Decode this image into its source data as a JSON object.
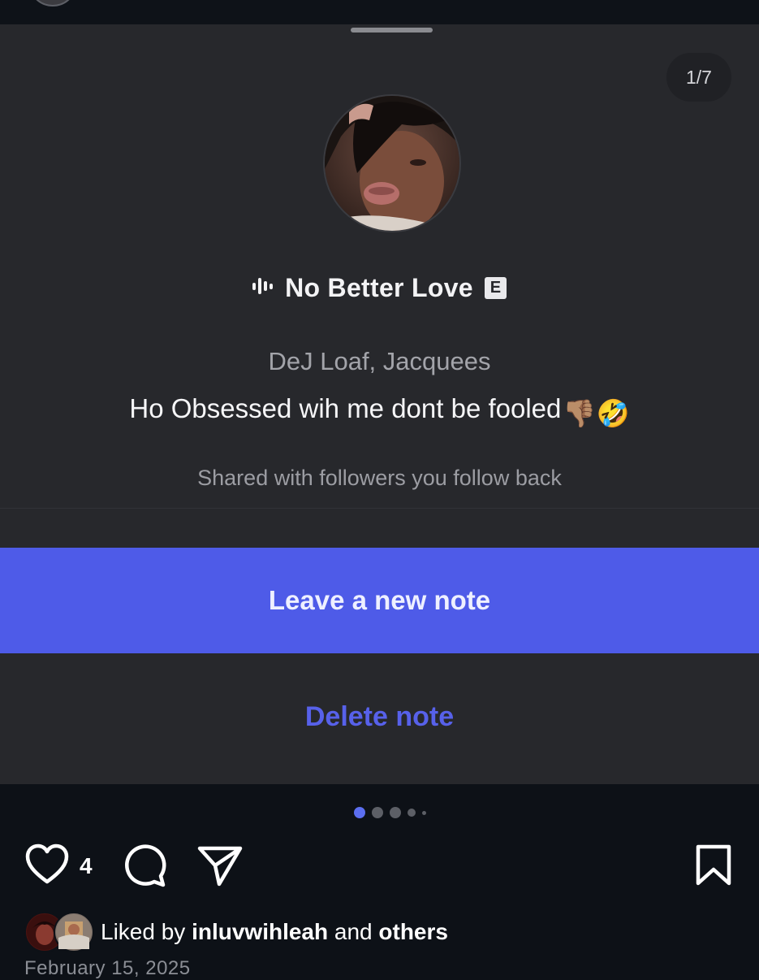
{
  "sheet": {
    "counter": "1/7",
    "song_title": "No Better Love",
    "explicit_badge": "E",
    "artist": "DeJ Loaf, Jacquees",
    "note_text": "Ho Obsessed wih me dont be fooled",
    "note_emojis": "👎🏽🤣",
    "shared_with": "Shared with followers you follow back",
    "primary_button": "Leave a new note",
    "delete_button": "Delete note"
  },
  "carousel": {
    "active_index": 0,
    "visible_dots": 5
  },
  "post": {
    "likes_count": "4",
    "liked_by_prefix": "Liked by",
    "liked_by_user": "inluvwihleah",
    "liked_by_joiner": "and",
    "liked_by_suffix": "others",
    "date": "February 15, 2025"
  },
  "icons": {
    "heart": "heart-icon",
    "comment": "comment-icon",
    "share": "paper-plane-icon",
    "bookmark": "bookmark-icon",
    "audio": "audio-wave-icon"
  },
  "colors": {
    "accent": "#4e5be8",
    "delete": "#5761ea",
    "sheet_bg": "#27282c",
    "page_bg": "#0d1117"
  }
}
